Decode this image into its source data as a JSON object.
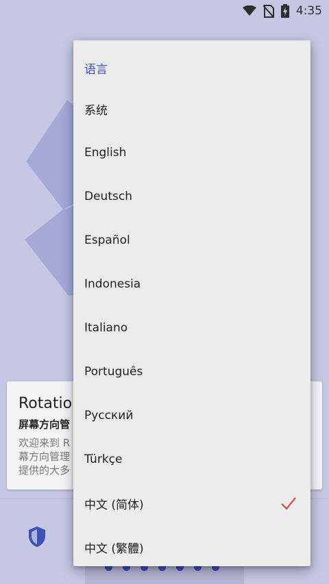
{
  "status_bar": {
    "time": "4:35",
    "icons": [
      "wifi-icon",
      "no-sim-icon",
      "battery-charging-icon"
    ]
  },
  "background": {
    "card_title": "Rotation",
    "card_subtitle": "屏幕方向管",
    "card_body": "欢迎来到 R\n幕方向管理\n提供的大多",
    "pager_count": 7
  },
  "dialog": {
    "title": "语言",
    "items": [
      {
        "label": "系统"
      },
      {
        "label": "English"
      },
      {
        "label": "Deutsch"
      },
      {
        "label": "Español"
      },
      {
        "label": "Indonesia"
      },
      {
        "label": "Italiano"
      },
      {
        "label": "Português"
      },
      {
        "label": "Русский"
      },
      {
        "label": "Türkçe"
      },
      {
        "label": "中文 (简体)",
        "selected": true
      },
      {
        "label": "中文 (繁體)"
      }
    ],
    "check_color": "#e53935",
    "accent_color": "#3f51b5"
  }
}
